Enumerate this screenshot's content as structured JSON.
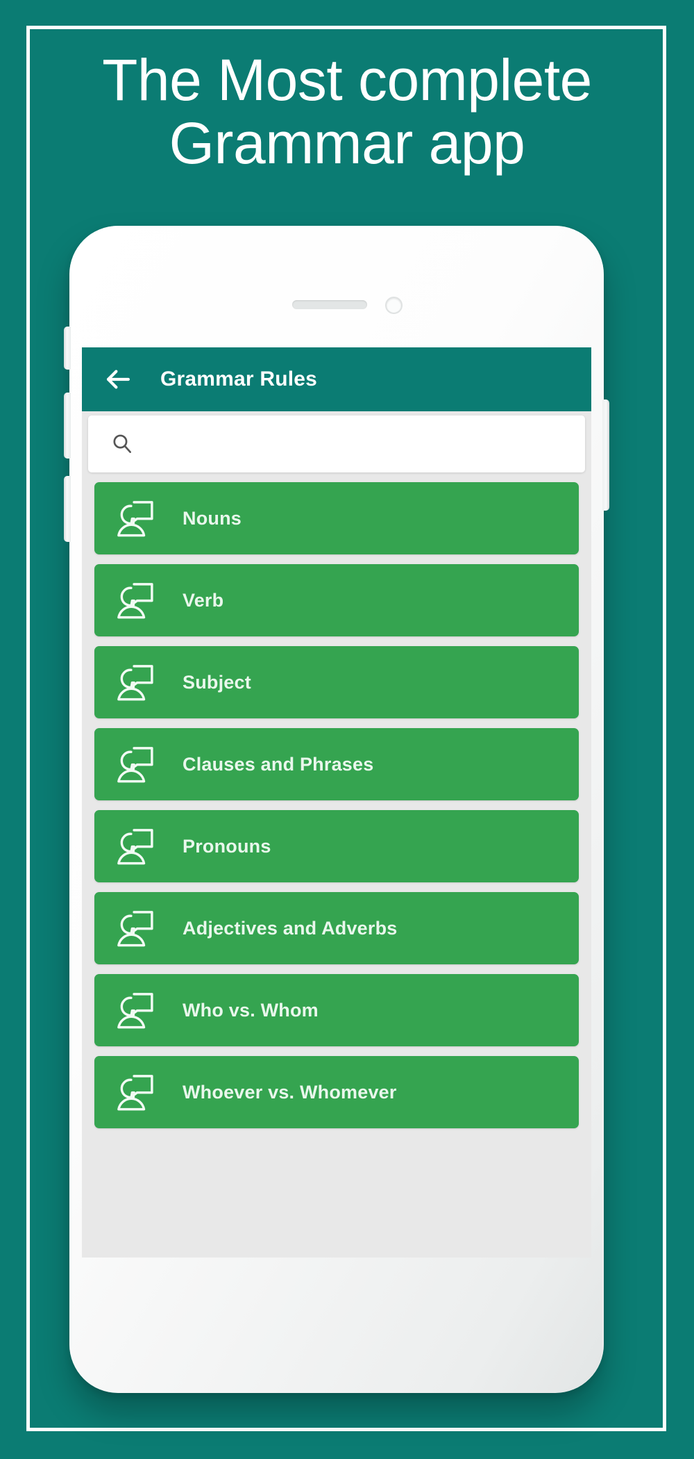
{
  "promo": {
    "headline_line1": "The Most complete",
    "headline_line2": "Grammar app",
    "background_color": "#0b7c73",
    "frame_color": "#ffffff"
  },
  "app": {
    "appbar": {
      "back_icon": "back-arrow-icon",
      "title": "Grammar Rules",
      "background_color": "#0b7c73",
      "text_color": "#ffffff"
    },
    "search": {
      "icon": "search-icon",
      "value": "",
      "placeholder": ""
    },
    "list": {
      "item_background_color": "#35a450",
      "item_text_color": "#e9f7ec",
      "item_icon": "person-speech-bubble-icon",
      "items": [
        {
          "label": "Nouns"
        },
        {
          "label": "Verb"
        },
        {
          "label": "Subject"
        },
        {
          "label": "Clauses and Phrases"
        },
        {
          "label": "Pronouns"
        },
        {
          "label": "Adjectives and Adverbs"
        },
        {
          "label": "Who vs. Whom"
        },
        {
          "label": "Whoever vs. Whomever"
        }
      ]
    }
  },
  "device": {
    "earpiece": "earpiece-speaker",
    "front_camera": "front-camera",
    "buttons": [
      "mute-switch",
      "volume-up-button",
      "volume-down-button",
      "power-button"
    ]
  }
}
